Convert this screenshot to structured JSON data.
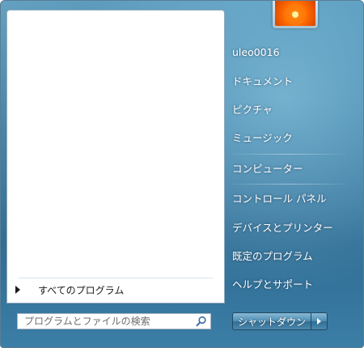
{
  "user": {
    "name": "uleo0016",
    "avatar_icon": "flower-avatar"
  },
  "left_pane": {
    "all_programs_label": "すべてのプログラム"
  },
  "search": {
    "placeholder": "プログラムとファイルの検索",
    "icon": "search-icon"
  },
  "right_pane": {
    "items": [
      {
        "label": "uleo0016"
      },
      {
        "label": "ドキュメント"
      },
      {
        "label": "ピクチャ"
      },
      {
        "label": "ミュージック"
      },
      {
        "label": "コンピューター"
      },
      {
        "label": "コントロール パネル"
      },
      {
        "label": "デバイスとプリンター"
      },
      {
        "label": "既定のプログラム"
      },
      {
        "label": "ヘルプとサポート"
      }
    ]
  },
  "shutdown": {
    "label": "シャットダウン",
    "arrow_icon": "chevron-right-icon"
  },
  "colors": {
    "accent": "#3c7ea4",
    "pane_background": "#ffffff"
  }
}
